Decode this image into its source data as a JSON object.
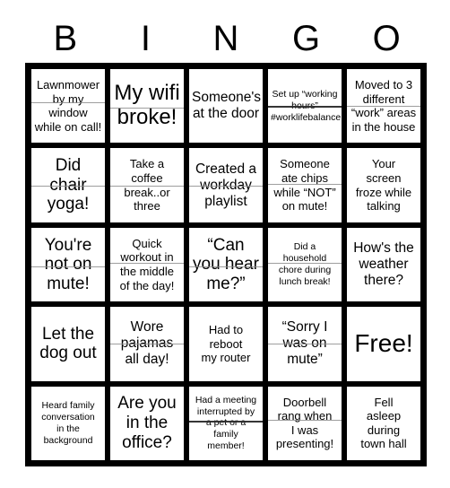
{
  "card": {
    "header_letters": [
      "B",
      "I",
      "N",
      "G",
      "O"
    ],
    "rows": [
      [
        {
          "text": "Lawnmower\nby my\nwindow\nwhile on call!",
          "size": "fs-s",
          "marked": true,
          "mark_top_pct": 45,
          "mark_style": "light"
        },
        {
          "text": "My wifi\nbroke!",
          "size": "fs-xl",
          "marked": true,
          "mark_top_pct": 52,
          "mark_style": "light"
        },
        {
          "text": "Someone's\nat the door",
          "size": "fs-m",
          "marked": false,
          "mark_top_pct": 50,
          "mark_style": "light"
        },
        {
          "text": "Set up “working\nhours”\n#worklifebalance",
          "size": "fs-xs",
          "marked": true,
          "mark_top_pct": 50,
          "mark_style": "dark"
        },
        {
          "text": "Moved to 3\ndifferent\n“work” areas\nin the house",
          "size": "fs-s",
          "marked": true,
          "mark_top_pct": 50,
          "mark_style": "light"
        }
      ],
      [
        {
          "text": "Did\nchair\nyoga!",
          "size": "fs-l",
          "marked": true,
          "mark_top_pct": 50,
          "mark_style": "light"
        },
        {
          "text": "Take a\ncoffee\nbreak..or\nthree",
          "size": "fs-s",
          "marked": true,
          "mark_top_pct": 50,
          "mark_style": "light"
        },
        {
          "text": "Created a\nworkday\nplaylist",
          "size": "fs-m",
          "marked": true,
          "mark_top_pct": 50,
          "mark_style": "light"
        },
        {
          "text": "Someone\nate chips\nwhile “NOT”\non mute!",
          "size": "fs-s",
          "marked": true,
          "mark_top_pct": 48,
          "mark_style": "light"
        },
        {
          "text": "Your\nscreen\nfroze while\ntalking",
          "size": "fs-s",
          "marked": false,
          "mark_top_pct": 50,
          "mark_style": "light"
        }
      ],
      [
        {
          "text": "You're\nnot on\nmute!",
          "size": "fs-l",
          "marked": true,
          "mark_top_pct": 52,
          "mark_style": "light"
        },
        {
          "text": "Quick\nworkout in\nthe middle\nof the day!",
          "size": "fs-s",
          "marked": true,
          "mark_top_pct": 48,
          "mark_style": "light"
        },
        {
          "text": "“Can\nyou hear\nme?”",
          "size": "fs-l",
          "marked": true,
          "mark_top_pct": 52,
          "mark_style": "light"
        },
        {
          "text": "Did a\nhousehold\nchore during\nlunch break!",
          "size": "fs-xs",
          "marked": true,
          "mark_top_pct": 48,
          "mark_style": "light"
        },
        {
          "text": "How's the\nweather\nthere?",
          "size": "fs-m",
          "marked": false,
          "mark_top_pct": 50,
          "mark_style": "light"
        }
      ],
      [
        {
          "text": "Let the\ndog out",
          "size": "fs-l",
          "marked": false,
          "mark_top_pct": 50,
          "mark_style": "light"
        },
        {
          "text": "Wore\npajamas\nall day!",
          "size": "fs-m",
          "marked": true,
          "mark_top_pct": 50,
          "mark_style": "light"
        },
        {
          "text": "Had to\nreboot\nmy router",
          "size": "fs-s",
          "marked": false,
          "mark_top_pct": 50,
          "mark_style": "light"
        },
        {
          "text": "“Sorry I\nwas on\nmute”",
          "size": "fs-m",
          "marked": true,
          "mark_top_pct": 50,
          "mark_style": "light"
        },
        {
          "text": "Free!",
          "size": "fs-xxl",
          "marked": false,
          "mark_top_pct": 50,
          "mark_style": "light"
        }
      ],
      [
        {
          "text": "Heard family\nconversation\nin the\nbackground",
          "size": "fs-xs",
          "marked": false,
          "mark_top_pct": 50,
          "mark_style": "light"
        },
        {
          "text": "Are you\nin the\noffice?",
          "size": "fs-l",
          "marked": false,
          "mark_top_pct": 50,
          "mark_style": "light"
        },
        {
          "text": "Had a meeting\ninterrupted by\na pet or a\nfamily\nmember!",
          "size": "fs-xs",
          "marked": true,
          "mark_top_pct": 47,
          "mark_style": "dark"
        },
        {
          "text": "Doorbell\nrang when\nI was\npresenting!",
          "size": "fs-s",
          "marked": true,
          "mark_top_pct": 45,
          "mark_style": "light"
        },
        {
          "text": "Fell\nasleep\nduring\ntown hall",
          "size": "fs-s",
          "marked": false,
          "mark_top_pct": 50,
          "mark_style": "light"
        }
      ]
    ]
  }
}
